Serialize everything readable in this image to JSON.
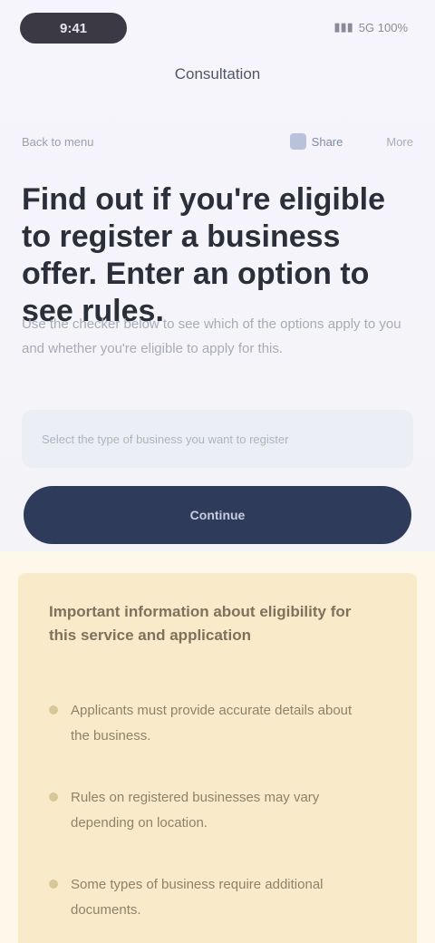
{
  "status": {
    "time": "9:41",
    "right_text": "5G 100%"
  },
  "nav": {
    "title": "Consultation"
  },
  "toolbar": {
    "back_label": "Back to menu",
    "share_label": "Share",
    "more_label": "More"
  },
  "headline": "Find out if you're eligible to register a business offer. Enter an option to see rules.",
  "subtext": "Use the checker below to see which of the options apply to you and whether you're eligible to apply for this.",
  "field": {
    "placeholder": "Select the type of business you want to register"
  },
  "cta": {
    "label": "Continue"
  },
  "card": {
    "title": "Important information about eligibility for this service and application",
    "items": [
      {
        "text": "Applicants must provide accurate details about the business."
      },
      {
        "text": "Rules on registered businesses may vary depending on location."
      },
      {
        "text": "Some types of business require additional documents."
      }
    ]
  },
  "colors": {
    "primary": "#2f3b5a",
    "card_bg": "#f9ebc9",
    "page_bg": "#f3f3f8"
  }
}
